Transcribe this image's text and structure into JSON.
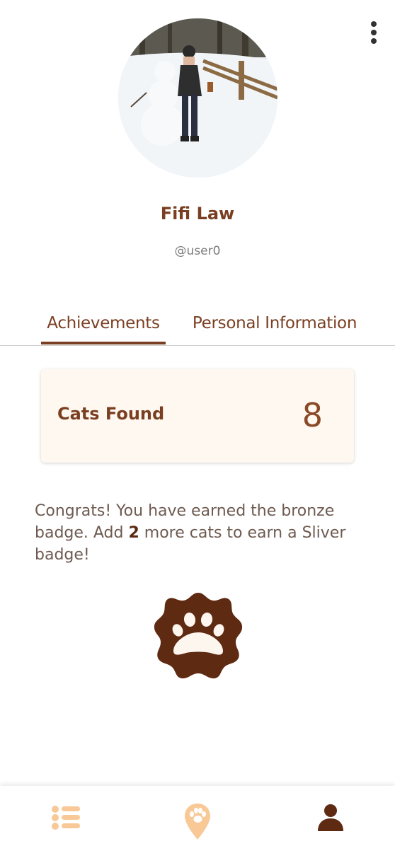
{
  "profile": {
    "name": "Fifi Law",
    "handle": "@user0",
    "avatar_alt": "profile photo"
  },
  "tabs": [
    {
      "label": "Achievements",
      "active": true
    },
    {
      "label": "Personal Information",
      "active": false
    }
  ],
  "stat": {
    "label": "Cats Found",
    "value": "8"
  },
  "message": {
    "part1": "Congrats! You have earned the bronze badge. Add ",
    "highlight": "2",
    "part2": " more cats to earn a Sliver badge!"
  },
  "badge": {
    "icon": "paw-badge-icon",
    "color": "#5e2a12"
  },
  "nav": {
    "items": [
      {
        "icon": "list-icon",
        "active": false
      },
      {
        "icon": "map-pin-icon",
        "active": false
      },
      {
        "icon": "person-icon",
        "active": true
      }
    ]
  },
  "colors": {
    "accent": "#7a3f22",
    "inactive_nav": "#f8c896",
    "card_bg": "#fff8f0"
  }
}
